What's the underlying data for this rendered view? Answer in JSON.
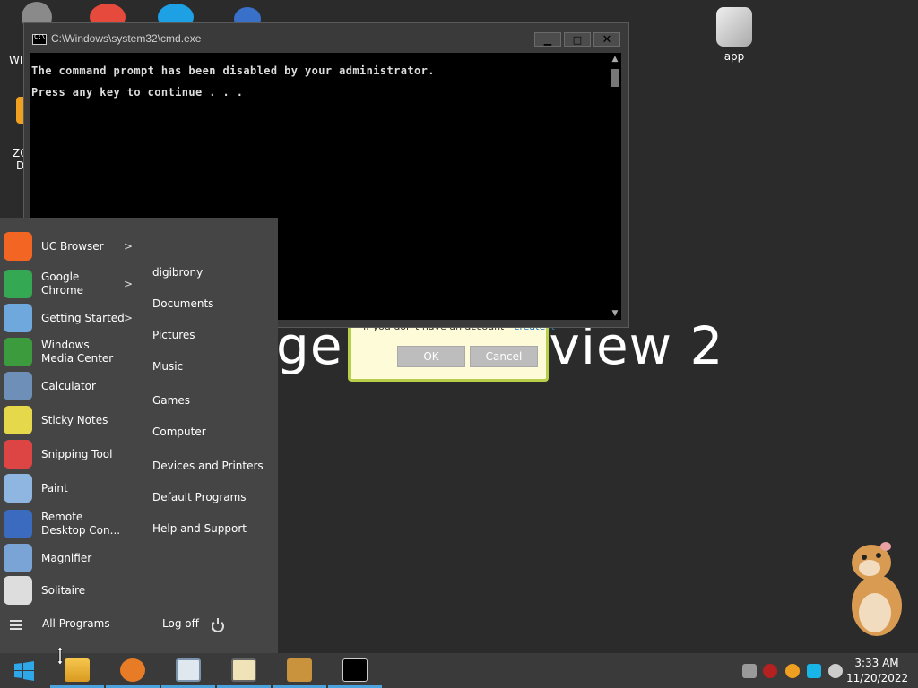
{
  "desktop": {
    "icons": {
      "app": "app",
      "win_partial": "WI",
      "zo_partial": "ZO",
      "d_partial": "D"
    },
    "background_text_left": "ge",
    "background_text_right": "view 2"
  },
  "login_dialog": {
    "hint_text": "If you don't have an account - ",
    "hint_link": "create it",
    "ok_label": "OK",
    "cancel_label": "Cancel"
  },
  "cmd_window": {
    "title": "C:\\Windows\\system32\\cmd.exe",
    "minimize": "▁",
    "maximize": "□",
    "close": "✕",
    "lines": [
      "The command prompt has been disabled by your administrator.",
      "Press any key to continue . . ."
    ]
  },
  "start_menu": {
    "programs": [
      {
        "label": "UC Browser",
        "color": "#f26522",
        "has_arrow": true
      },
      {
        "label": "Google\nChrome",
        "color": "#34a853",
        "has_arrow": true
      },
      {
        "label": "Getting Started",
        "color": "#6fa8dc",
        "has_arrow": true
      },
      {
        "label": "Windows\nMedia Center",
        "color": "#3c9b3c",
        "has_arrow": false
      },
      {
        "label": "Calculator",
        "color": "#6d8fb8",
        "has_arrow": false
      },
      {
        "label": "Sticky Notes",
        "color": "#e5d84a",
        "has_arrow": false
      },
      {
        "label": "Snipping Tool",
        "color": "#d44",
        "has_arrow": false
      },
      {
        "label": "Paint",
        "color": "#8fb6e0",
        "has_arrow": false
      },
      {
        "label": "Remote\nDesktop Con...",
        "color": "#3a6bbf",
        "has_arrow": false
      },
      {
        "label": "Magnifier",
        "color": "#7aa3d6",
        "has_arrow": false
      },
      {
        "label": "Solitaire",
        "color": "#ddd",
        "has_arrow": false
      }
    ],
    "places": [
      "digibrony",
      "Documents",
      "Pictures",
      "Music",
      "Games",
      "Computer",
      "Devices and Printers",
      "Default Programs",
      "Help and Support"
    ],
    "all_programs": "All Programs",
    "log_off": "Log off",
    "arrow": ">"
  },
  "taskbar": {
    "time": "3:33 AM",
    "date": "11/20/2022"
  }
}
